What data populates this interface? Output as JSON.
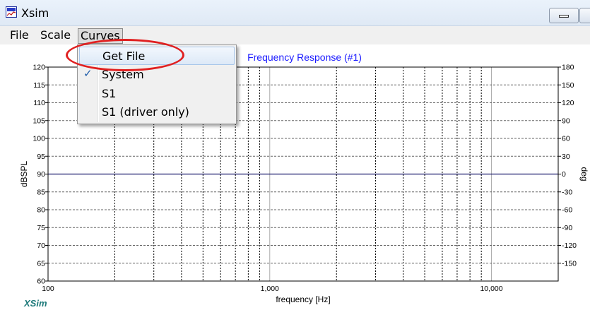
{
  "window": {
    "title": "Xsim",
    "icon": "xsim-app-icon"
  },
  "menubar": {
    "items": [
      "File",
      "Scale",
      "Curves"
    ]
  },
  "dropdown": {
    "items": [
      {
        "label": "Get File",
        "checked": false,
        "highlighted": true
      },
      {
        "label": "System",
        "checked": true,
        "highlighted": false
      },
      {
        "label": "S1",
        "checked": false,
        "highlighted": false
      },
      {
        "label": "S1 (driver only)",
        "checked": false,
        "highlighted": false
      }
    ],
    "annotation_color": "#e02020"
  },
  "chart_data": {
    "type": "line",
    "title": "Frequency Response (#1)",
    "xlabel": "frequency [Hz]",
    "ylabel": "dBSPL",
    "y2label": "deg",
    "x_scale": "log",
    "xlim": [
      100,
      20000
    ],
    "ylim": [
      60,
      120
    ],
    "y2lim": [
      -180,
      180
    ],
    "x_ticks": [
      100,
      1000,
      10000
    ],
    "x_tick_labels": [
      "100",
      "1,000",
      "10,000"
    ],
    "y_ticks": [
      60,
      65,
      70,
      75,
      80,
      85,
      90,
      95,
      100,
      105,
      110,
      115,
      120
    ],
    "y_tick_labels": [
      "60",
      "65",
      "70",
      "75",
      "80",
      "85",
      "90",
      "95",
      "100",
      "105",
      "110",
      "115",
      "120"
    ],
    "y2_ticks": [
      -150,
      -120,
      -90,
      -60,
      -30,
      0,
      30,
      60,
      90,
      120,
      150,
      180
    ],
    "y2_tick_labels": [
      "-150",
      "-120",
      "-90",
      "-60",
      "-30",
      "0",
      "30",
      "60",
      "90",
      "120",
      "150",
      "180"
    ],
    "reference_line_y": 90,
    "grid": true,
    "series": [],
    "watermark": "XSim",
    "title_color": "#1a1aff",
    "watermark_color": "#1e7a7a"
  }
}
